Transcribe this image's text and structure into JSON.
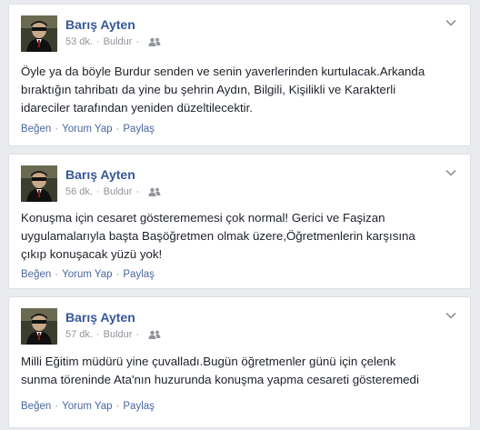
{
  "posts": [
    {
      "author": "Barış Ayten",
      "time": "53 dk.",
      "location": "Buldur",
      "text_lines": [
        "Öyle ya da böyle Burdur senden ve senin yaverlerinden kurtulacak.Arkanda",
        "bıraktığın tahribatı da yine bu şehrin Aydın, Bilgili, Kişilikli ve Karakterli",
        "idareciler tarafından yeniden düzeltilecektir."
      ],
      "actions": {
        "like": "Beğen",
        "comment": "Yorum Yap",
        "share": "Paylaş"
      }
    },
    {
      "author": "Barış Ayten",
      "time": "56 dk.",
      "location": "Buldur",
      "text_lines": [
        "Konuşma için cesaret gösterememesi çok normal! Gerici ve Faşizan",
        "uygulamalarıyla başta Başöğretmen olmak üzere,Öğretmenlerin karşısına",
        "çıkıp konuşacak yüzü yok!"
      ],
      "actions": {
        "like": "Beğen",
        "comment": "Yorum Yap",
        "share": "Paylaş"
      }
    },
    {
      "author": "Barış Ayten",
      "time": "57 dk.",
      "location": "Buldur",
      "text_lines": [
        "Milli Eğitim müdürü yine çuvalladı.Bugün öğretmenler günü için çelenk",
        "sunma töreninde Ata'nın huzurunda konuşma yapma cesareti gösteremedi"
      ],
      "actions": {
        "like": "Beğen",
        "comment": "Yorum Yap",
        "share": "Paylaş"
      }
    }
  ],
  "meta_separator": "·",
  "action_separator": "·",
  "icons": {
    "audience": "friends-icon",
    "menu": "chevron-down-icon",
    "avatar": "profile-photo"
  },
  "colors": {
    "background": "#e9ebee",
    "author": "#365899",
    "link": "#4b67a1",
    "meta": "#90949c",
    "text": "#1d2129"
  }
}
